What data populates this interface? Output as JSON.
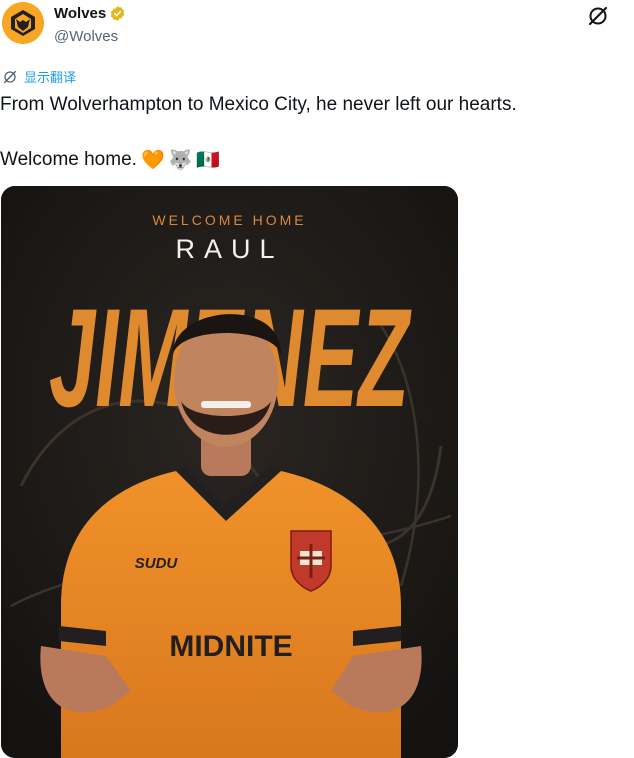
{
  "account": {
    "display_name": "Wolves",
    "handle": "@Wolves",
    "verified": true
  },
  "actions": {
    "grok_icon": "grok-icon",
    "more_icon": "more-icon"
  },
  "translate": {
    "label": "显示翻译"
  },
  "tweet": {
    "line1": "From Wolverhampton to Mexico City, he never left our hearts.",
    "line2": "Welcome home.",
    "emojis": [
      "🧡",
      "🐺",
      "🇲🇽"
    ]
  },
  "media": {
    "headline": "WELCOME HOME",
    "first_name": "RAUL",
    "last_name": "JIMENEZ",
    "shirt_brand": "SUDU",
    "shirt_sponsor": "MIDNITE",
    "colors": {
      "brand_orange": "#e08a2f",
      "background": "#1f1b18"
    }
  }
}
